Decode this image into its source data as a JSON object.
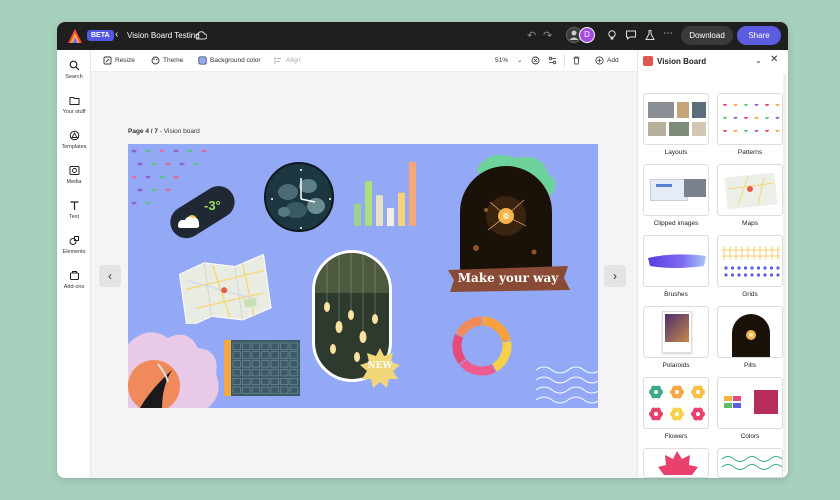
{
  "app": {
    "beta_label": "BETA",
    "doc_title": "Vision Board Testing",
    "avatar_initial": "D",
    "download_label": "Download",
    "share_label": "Share"
  },
  "rail": {
    "items": [
      {
        "label": "Search",
        "icon": "search-icon"
      },
      {
        "label": "Your stuff",
        "icon": "folder-icon"
      },
      {
        "label": "Templates",
        "icon": "templates-icon"
      },
      {
        "label": "Media",
        "icon": "media-icon"
      },
      {
        "label": "Text",
        "icon": "text-icon"
      },
      {
        "label": "Elements",
        "icon": "elements-icon"
      },
      {
        "label": "Add-ons",
        "icon": "addons-icon"
      }
    ]
  },
  "toolbar": {
    "resize_label": "Resize",
    "theme_label": "Theme",
    "bg_label": "Background color",
    "align_label": "Align",
    "zoom": "51%",
    "add_label": "Add"
  },
  "canvas": {
    "page_num": "Page 4 / 7",
    "page_name": " - Vision board",
    "weather_temp": "-3°",
    "banner_text": "Make your way",
    "badge_text": "NEW",
    "bar_heights": [
      0.35,
      0.7,
      0.48,
      0.28,
      0.52,
      1.0
    ],
    "bar_colors": [
      "#9fd090",
      "#a9e07c",
      "#e6e2c2",
      "#f2f0e6",
      "#f7d27a",
      "#f3a77a"
    ],
    "donut_segments": [
      {
        "value": 0.22,
        "color": "#f7a23c"
      },
      {
        "value": 0.2,
        "color": "#f7d04a"
      },
      {
        "value": 0.22,
        "color": "#ef5b8f"
      },
      {
        "value": 0.18,
        "color": "#e84a7b"
      },
      {
        "value": 0.18,
        "color": "#f08a5a"
      }
    ],
    "background_color": "#93a9f5"
  },
  "panel": {
    "title": "Vision Board",
    "tiles": [
      {
        "label": "Layouts"
      },
      {
        "label": "Patterns"
      },
      {
        "label": "Clipped images"
      },
      {
        "label": "Maps"
      },
      {
        "label": "Brushes"
      },
      {
        "label": "Grids"
      },
      {
        "label": "Polaroids"
      },
      {
        "label": "Pills"
      },
      {
        "label": "Flowers"
      },
      {
        "label": "Colors"
      }
    ]
  }
}
